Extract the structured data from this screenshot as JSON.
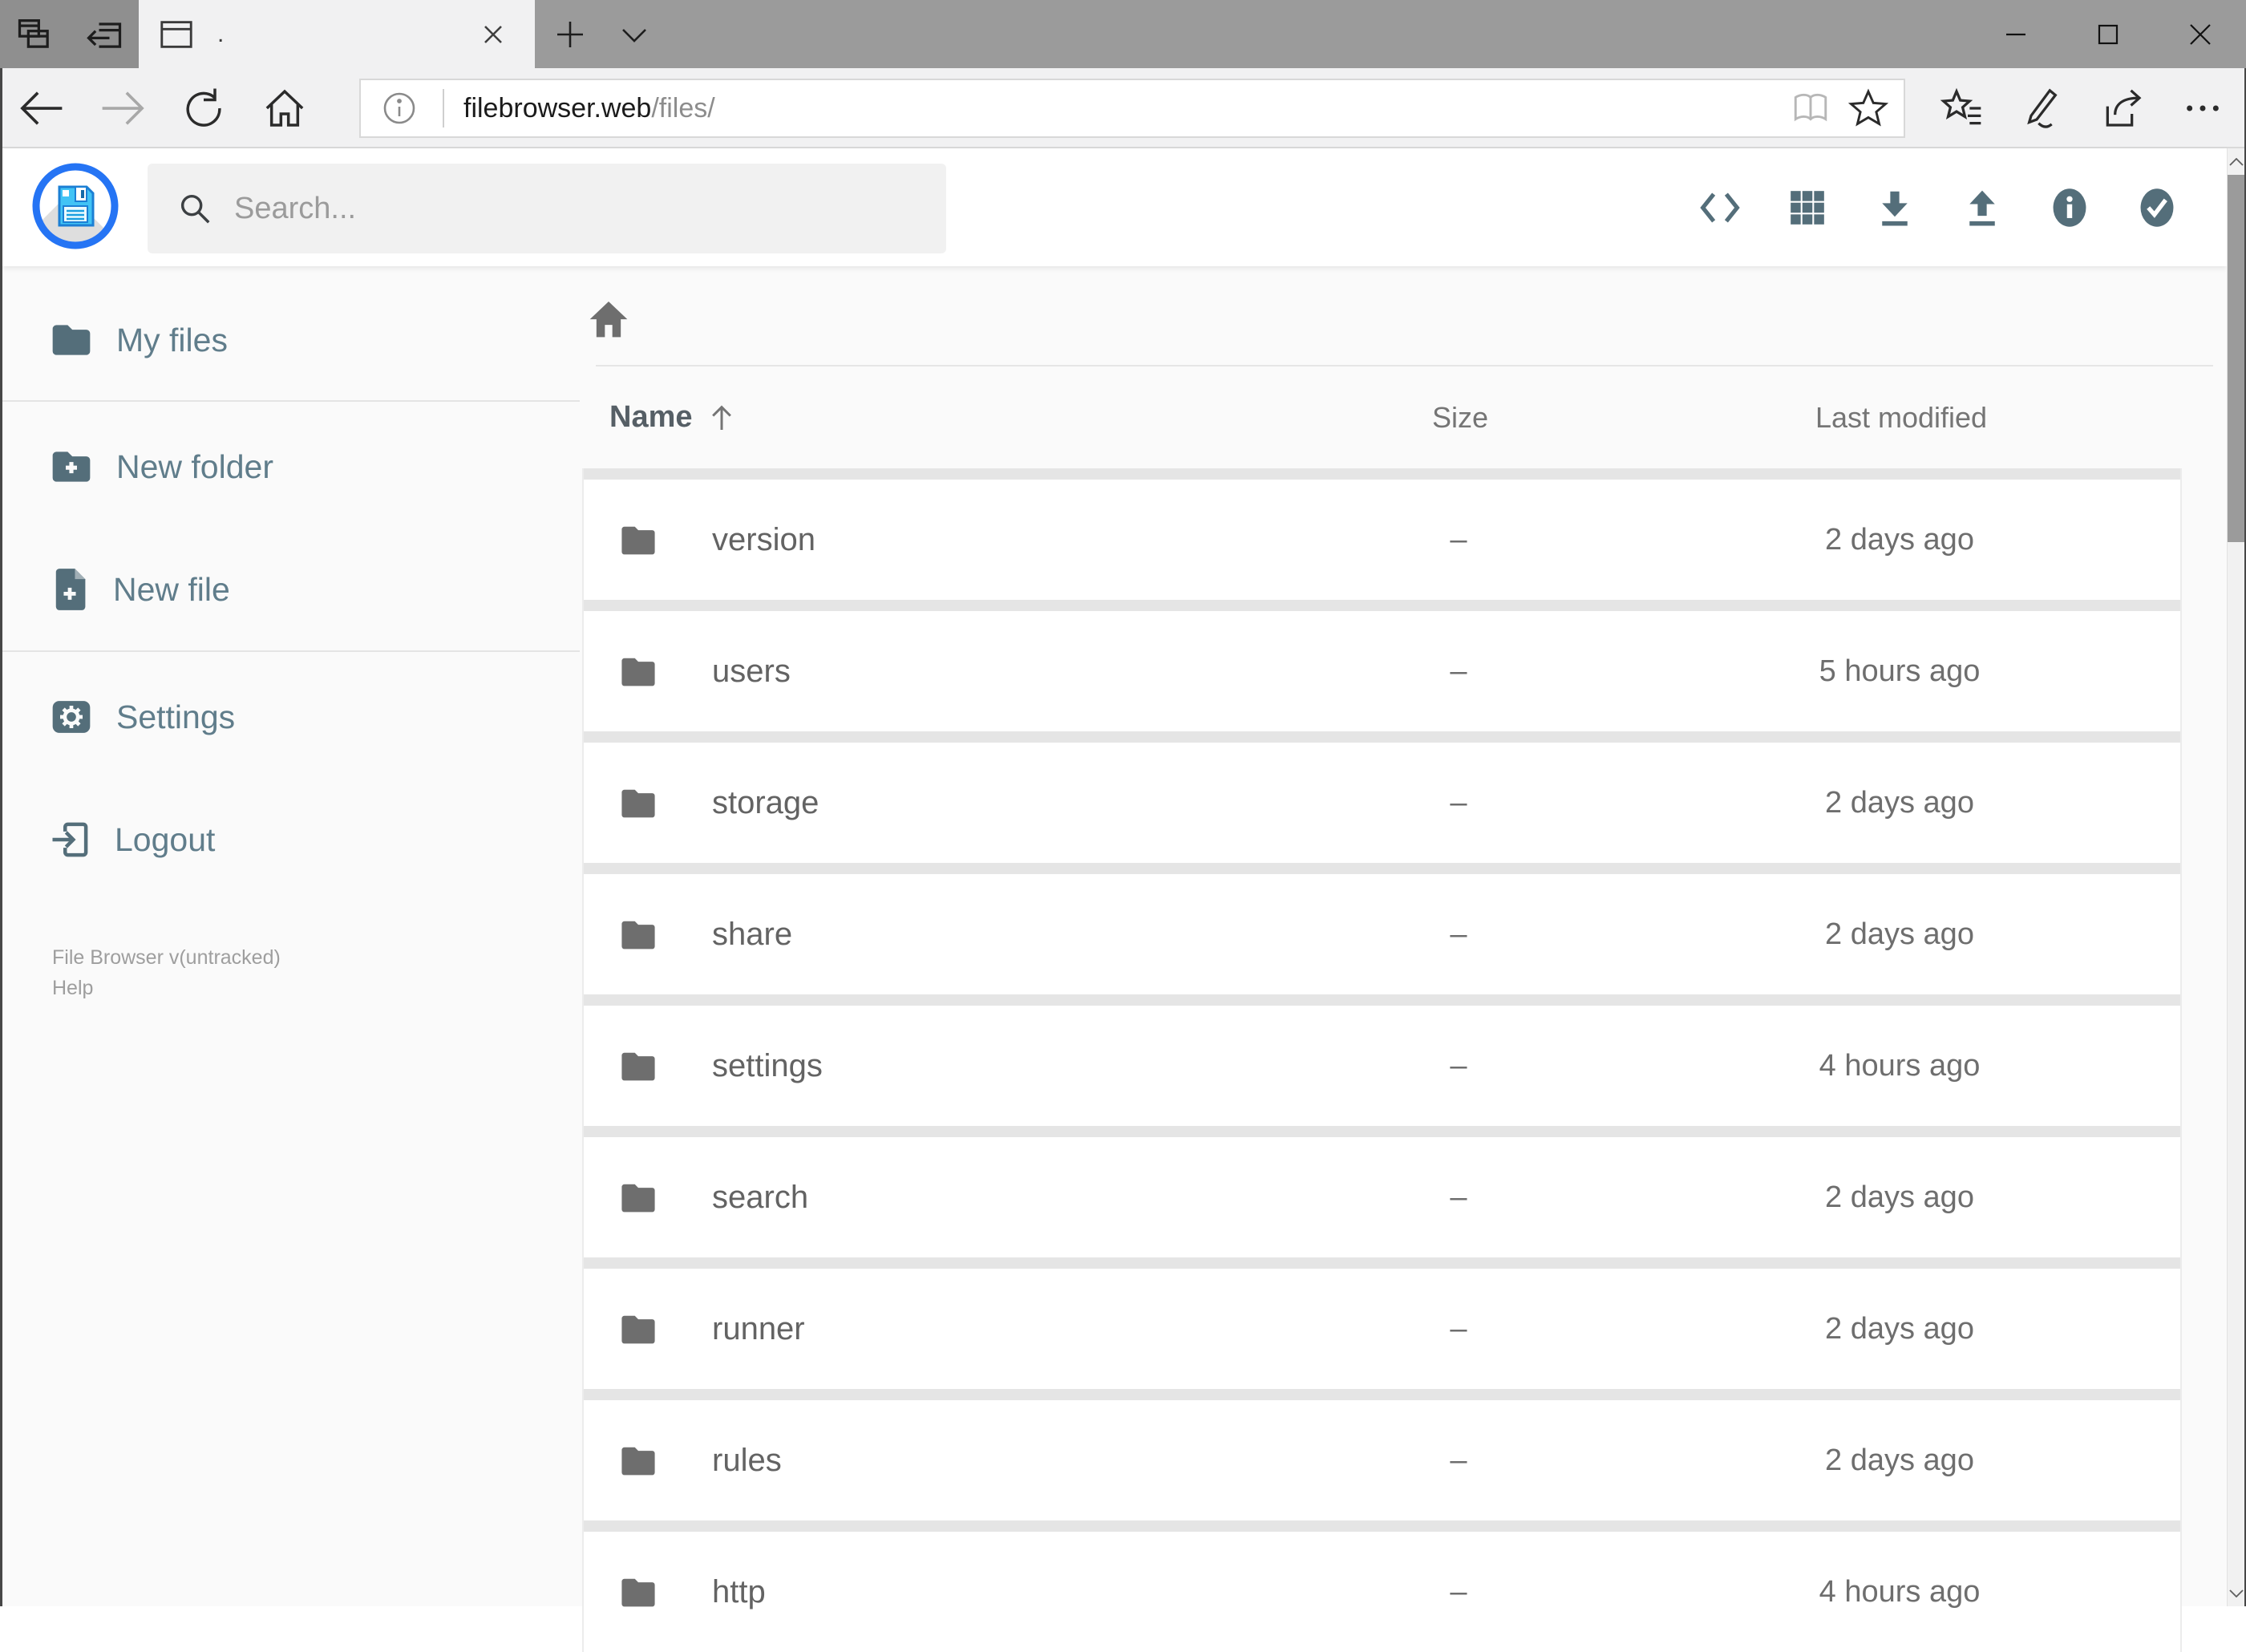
{
  "window": {
    "tab_title": "."
  },
  "navbar": {
    "url_host": "filebrowser.web",
    "url_path": "/files/"
  },
  "app_header": {
    "search_placeholder": "Search..."
  },
  "sidebar": {
    "items": [
      {
        "label": "My files",
        "icon": "folder-icon"
      },
      {
        "label": "New folder",
        "icon": "folder-plus-icon"
      },
      {
        "label": "New file",
        "icon": "file-plus-icon"
      },
      {
        "label": "Settings",
        "icon": "gear-icon"
      },
      {
        "label": "Logout",
        "icon": "logout-icon"
      }
    ],
    "footer_version": "File Browser v(untracked)",
    "footer_help": "Help"
  },
  "listing": {
    "columns": {
      "name": "Name",
      "size": "Size",
      "modified": "Last modified"
    },
    "sort": {
      "column": "Name",
      "direction": "ascending"
    },
    "files": [
      {
        "name": "version",
        "size": "–",
        "modified": "2 days ago",
        "type": "folder"
      },
      {
        "name": "users",
        "size": "–",
        "modified": "5 hours ago",
        "type": "folder"
      },
      {
        "name": "storage",
        "size": "–",
        "modified": "2 days ago",
        "type": "folder"
      },
      {
        "name": "share",
        "size": "–",
        "modified": "2 days ago",
        "type": "folder"
      },
      {
        "name": "settings",
        "size": "–",
        "modified": "4 hours ago",
        "type": "folder"
      },
      {
        "name": "search",
        "size": "–",
        "modified": "2 days ago",
        "type": "folder"
      },
      {
        "name": "runner",
        "size": "–",
        "modified": "2 days ago",
        "type": "folder"
      },
      {
        "name": "rules",
        "size": "–",
        "modified": "2 days ago",
        "type": "folder"
      },
      {
        "name": "http",
        "size": "–",
        "modified": "4 hours ago",
        "type": "folder"
      }
    ]
  },
  "colors": {
    "accent_blue": "#2574f4",
    "logo_floppy": "#41c3f5",
    "slate_text": "#607d8b",
    "slate_icon": "#546e7a",
    "row_gray": "#6e6e6e",
    "titlebar_gray": "#9b9b9b",
    "chrome_bg": "#f1f1f2",
    "band_gray": "#e5e5e5"
  }
}
